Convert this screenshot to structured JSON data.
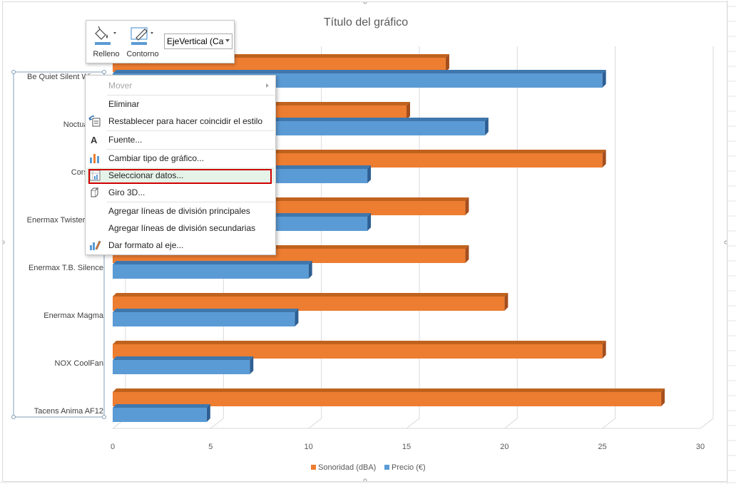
{
  "chart_data": {
    "type": "bar",
    "orientation": "horizontal",
    "title": "Título del gráfico",
    "categories": [
      "Be Quiet Silent Wings",
      "Noctua NF-",
      "Corsair A",
      "Enermax Twister Pres",
      "Enermax T.B. Silence",
      "Enermax Magma",
      "NOX CoolFan",
      "Tacens Anima AF12"
    ],
    "series": [
      {
        "name": "Sonoridad (dBA)",
        "color": "#ed7d31",
        "values": [
          17,
          15,
          25,
          18,
          18,
          20,
          25,
          28
        ]
      },
      {
        "name": "Precio (€)",
        "color": "#5b9bd5",
        "values": [
          25,
          19,
          13,
          13,
          10,
          9.3,
          7,
          4.8
        ]
      }
    ],
    "x_ticks": [
      "0",
      "5",
      "10",
      "15",
      "20",
      "25",
      "30"
    ],
    "xlim": [
      0,
      30
    ],
    "grid": true,
    "legend_position": "bottom"
  },
  "toolbar": {
    "fill_label": "Relleno",
    "outline_label": "Contorno",
    "element_select_value": "EjeVertical (Cat"
  },
  "context_menu": {
    "items": [
      {
        "label": "Mover",
        "icon": "none",
        "disabled": true,
        "submenu": true
      },
      {
        "label": "Eliminar",
        "icon": "none"
      },
      {
        "label": "Restablecer para hacer coincidir el estilo",
        "icon": "reset-style-icon"
      },
      {
        "label": "Fuente...",
        "icon": "font-icon"
      },
      {
        "label": "Cambiar tipo de gráfico...",
        "icon": "chart-type-icon"
      },
      {
        "label": "Seleccionar datos...",
        "icon": "select-data-icon",
        "highlighted": true
      },
      {
        "label": "Giro 3D...",
        "icon": "rotate-3d-icon"
      },
      {
        "label": "Agregar líneas de división principales",
        "icon": "none"
      },
      {
        "label": "Agregar líneas de división secundarias",
        "icon": "none"
      },
      {
        "label": "Dar formato al eje...",
        "icon": "format-axis-icon"
      }
    ]
  },
  "colors": {
    "accent_highlight": "#d00000",
    "menu_hover": "#e5f3e9"
  }
}
